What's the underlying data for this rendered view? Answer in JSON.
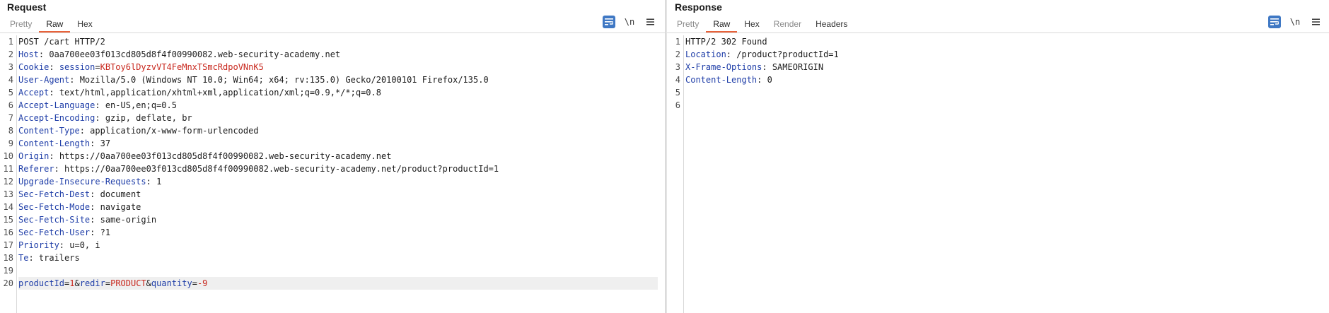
{
  "request": {
    "title": "Request",
    "tabs": [
      "Pretty",
      "Raw",
      "Hex"
    ],
    "active_tab": "Raw",
    "toolbar": {
      "newline": "\\n"
    },
    "lines": [
      {
        "n": "1",
        "name": "",
        "value": "POST /cart HTTP/2"
      },
      {
        "n": "2",
        "name": "Host",
        "value": "0aa700ee03f013cd805d8f4f00990082.web-security-academy.net"
      },
      {
        "n": "3",
        "name": "Cookie",
        "value": ""
      },
      {
        "n": "4",
        "name": "User-Agent",
        "value": "Mozilla/5.0 (Windows NT 10.0; Win64; x64; rv:135.0) Gecko/20100101 Firefox/135.0"
      },
      {
        "n": "5",
        "name": "Accept",
        "value": "text/html,application/xhtml+xml,application/xml;q=0.9,*/*;q=0.8"
      },
      {
        "n": "6",
        "name": "Accept-Language",
        "value": "en-US,en;q=0.5"
      },
      {
        "n": "7",
        "name": "Accept-Encoding",
        "value": "gzip, deflate, br"
      },
      {
        "n": "8",
        "name": "Content-Type",
        "value": "application/x-www-form-urlencoded"
      },
      {
        "n": "9",
        "name": "Content-Length",
        "value": "37"
      },
      {
        "n": "10",
        "name": "Origin",
        "value": "https://0aa700ee03f013cd805d8f4f00990082.web-security-academy.net"
      },
      {
        "n": "11",
        "name": "Referer",
        "value": "https://0aa700ee03f013cd805d8f4f00990082.web-security-academy.net/product?productId=1"
      },
      {
        "n": "12",
        "name": "Upgrade-Insecure-Requests",
        "value": "1"
      },
      {
        "n": "13",
        "name": "Sec-Fetch-Dest",
        "value": "document"
      },
      {
        "n": "14",
        "name": "Sec-Fetch-Mode",
        "value": "navigate"
      },
      {
        "n": "15",
        "name": "Sec-Fetch-Site",
        "value": "same-origin"
      },
      {
        "n": "16",
        "name": "Sec-Fetch-User",
        "value": "?1"
      },
      {
        "n": "17",
        "name": "Priority",
        "value": "u=0, i"
      },
      {
        "n": "18",
        "name": "Te",
        "value": "trailers"
      },
      {
        "n": "19",
        "name": "",
        "value": ""
      },
      {
        "n": "20",
        "name": "",
        "value": ""
      }
    ],
    "cookie": {
      "key": "session",
      "eq": "=",
      "val": "KBToy6lDyzvVT4FeMnxTSmcRdpoVNnK5"
    },
    "body": {
      "k1": "productId",
      "v1": "1",
      "amp1": "&",
      "k2": "redir",
      "v2": "PRODUCT",
      "amp2": "&",
      "k3": "quantity",
      "v3": "-9",
      "eq": "="
    }
  },
  "response": {
    "title": "Response",
    "tabs": [
      "Pretty",
      "Raw",
      "Hex",
      "Render",
      "Headers"
    ],
    "active_tab": "Raw",
    "toolbar": {
      "newline": "\\n"
    },
    "lines": [
      {
        "n": "1",
        "name": "",
        "value": "HTTP/2 302 Found"
      },
      {
        "n": "2",
        "name": "Location",
        "value": "/product?productId=1"
      },
      {
        "n": "3",
        "name": "X-Frame-Options",
        "value": "SAMEORIGIN"
      },
      {
        "n": "4",
        "name": "Content-Length",
        "value": "0"
      },
      {
        "n": "5",
        "name": "",
        "value": ""
      },
      {
        "n": "6",
        "name": "",
        "value": ""
      }
    ]
  },
  "colors": {
    "accent": "#e8623a",
    "header_name": "#1f3ea8",
    "value_red": "#c8271d",
    "toolbar_primary": "#3f78c4"
  }
}
